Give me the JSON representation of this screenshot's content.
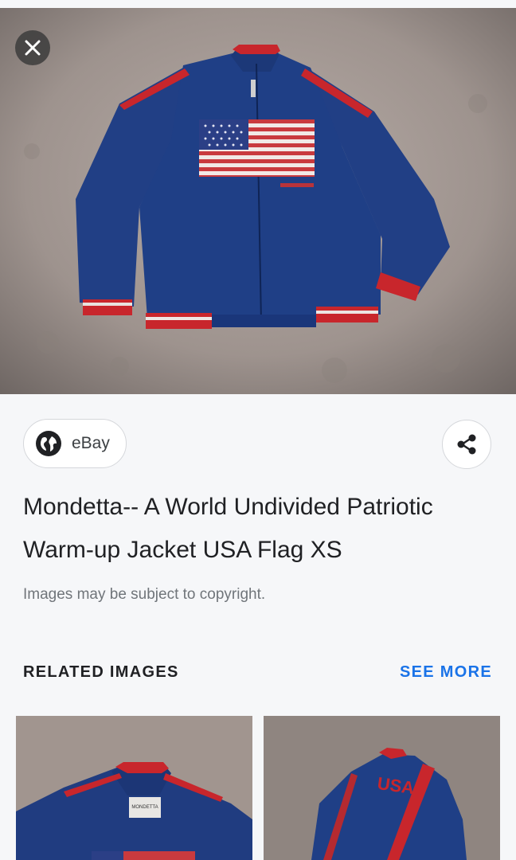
{
  "viewer": {
    "close_icon": "close-icon",
    "hero_image_alt": "Blue Mondetta jacket with USA flag laid on carpet"
  },
  "source": {
    "icon": "globe-icon",
    "label": "eBay"
  },
  "share": {
    "icon": "share-icon"
  },
  "result": {
    "title": "Mondetta-- A World Undivided Patriotic Warm-up Jacket USA Flag XS",
    "copyright_note": "Images may be subject to copyright."
  },
  "related": {
    "heading": "RELATED IMAGES",
    "see_more_label": "SEE MORE",
    "thumbnails": [
      {
        "caption": "MONDETTA"
      },
      {
        "caption": "USA"
      }
    ]
  },
  "colors": {
    "accent": "#1a73e8",
    "jacket_navy": "#1f3f86",
    "stripe_red": "#c8262c"
  }
}
